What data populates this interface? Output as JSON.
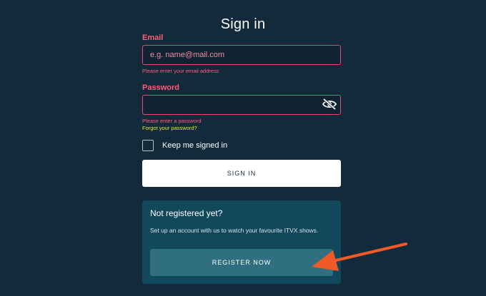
{
  "page": {
    "title": "Sign in"
  },
  "email": {
    "label": "Email",
    "placeholder": "e.g. name@mail.com",
    "value": "",
    "error": "Please enter your email address"
  },
  "password": {
    "label": "Password",
    "value": "",
    "error": "Please enter a password",
    "forgot_link": "Forgot your password?",
    "toggle_icon": "eye-slash-icon"
  },
  "keep_signed_in": {
    "label": "Keep me signed in",
    "checked": false
  },
  "signin": {
    "label": "SIGN IN"
  },
  "register": {
    "title": "Not registered yet?",
    "description": "Set up an account with us to watch your favourite ITVX shows.",
    "button_label": "REGISTER NOW"
  },
  "colors": {
    "background": "#122a3a",
    "error": "#ff5c7c",
    "link": "#e9e33b",
    "register_panel": "#12485c",
    "register_button": "#2f6f7f",
    "annotation_arrow": "#f05a28"
  }
}
